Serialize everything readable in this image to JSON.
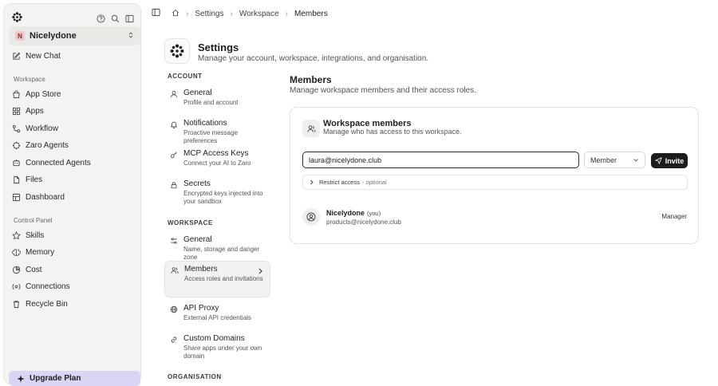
{
  "sidebar": {
    "org_initial": "N",
    "org_name": "Nicelydone",
    "new_chat": "New Chat",
    "workspace_section": "Workspace",
    "workspace_items": [
      {
        "label": "App Store",
        "icon": "app-store-icon"
      },
      {
        "label": "Apps",
        "icon": "apps-icon"
      },
      {
        "label": "Workflow",
        "icon": "workflow-icon"
      },
      {
        "label": "Zaro Agents",
        "icon": "agents-icon"
      },
      {
        "label": "Connected Agents",
        "icon": "connected-agents-icon"
      },
      {
        "label": "Files",
        "icon": "files-icon"
      },
      {
        "label": "Dashboard",
        "icon": "dashboard-icon"
      }
    ],
    "control_section": "Control Panel",
    "control_items": [
      {
        "label": "Skills",
        "icon": "skills-icon"
      },
      {
        "label": "Memory",
        "icon": "memory-icon"
      },
      {
        "label": "Cost",
        "icon": "cost-icon"
      },
      {
        "label": "Connections",
        "icon": "connections-icon"
      },
      {
        "label": "Recycle Bin",
        "icon": "recycle-bin-icon"
      }
    ],
    "upgrade": "Upgrade Plan"
  },
  "breadcrumb": [
    "Settings",
    "Workspace",
    "Members"
  ],
  "settings": {
    "title": "Settings",
    "subtitle": "Manage your account, workspace, integrations, and organisation."
  },
  "nav": {
    "account_section": "ACCOUNT",
    "account_items": [
      {
        "title": "General",
        "desc": "Profile and account"
      },
      {
        "title": "Notifications",
        "desc": "Proactive message preferences"
      },
      {
        "title": "MCP Access Keys",
        "desc": "Connect your AI to Zaro"
      },
      {
        "title": "Secrets",
        "desc": "Encrypted keys injected into your sandbox"
      }
    ],
    "workspace_section": "WORKSPACE",
    "workspace_items": [
      {
        "title": "General",
        "desc": "Name, storage and danger zone"
      },
      {
        "title": "Members",
        "desc": "Access roles and invitations"
      },
      {
        "title": "API Proxy",
        "desc": "External API credentials"
      },
      {
        "title": "Custom Domains",
        "desc": "Share apps under your own domain"
      }
    ],
    "organisation_section": "ORGANISATION"
  },
  "content": {
    "title": "Members",
    "subtitle": "Manage workspace members and their access roles."
  },
  "card": {
    "title": "Workspace members",
    "subtitle": "Manage who has access to this workspace.",
    "email_value": "laura@nicelydone.club",
    "role_value": "Member",
    "invite_label": "Invite",
    "restrict_label": "Restrict access",
    "restrict_optional": "- optional",
    "member": {
      "name": "Nicelydone",
      "you": "(you)",
      "email": "products@nicelydone.club",
      "role": "Manager"
    }
  }
}
